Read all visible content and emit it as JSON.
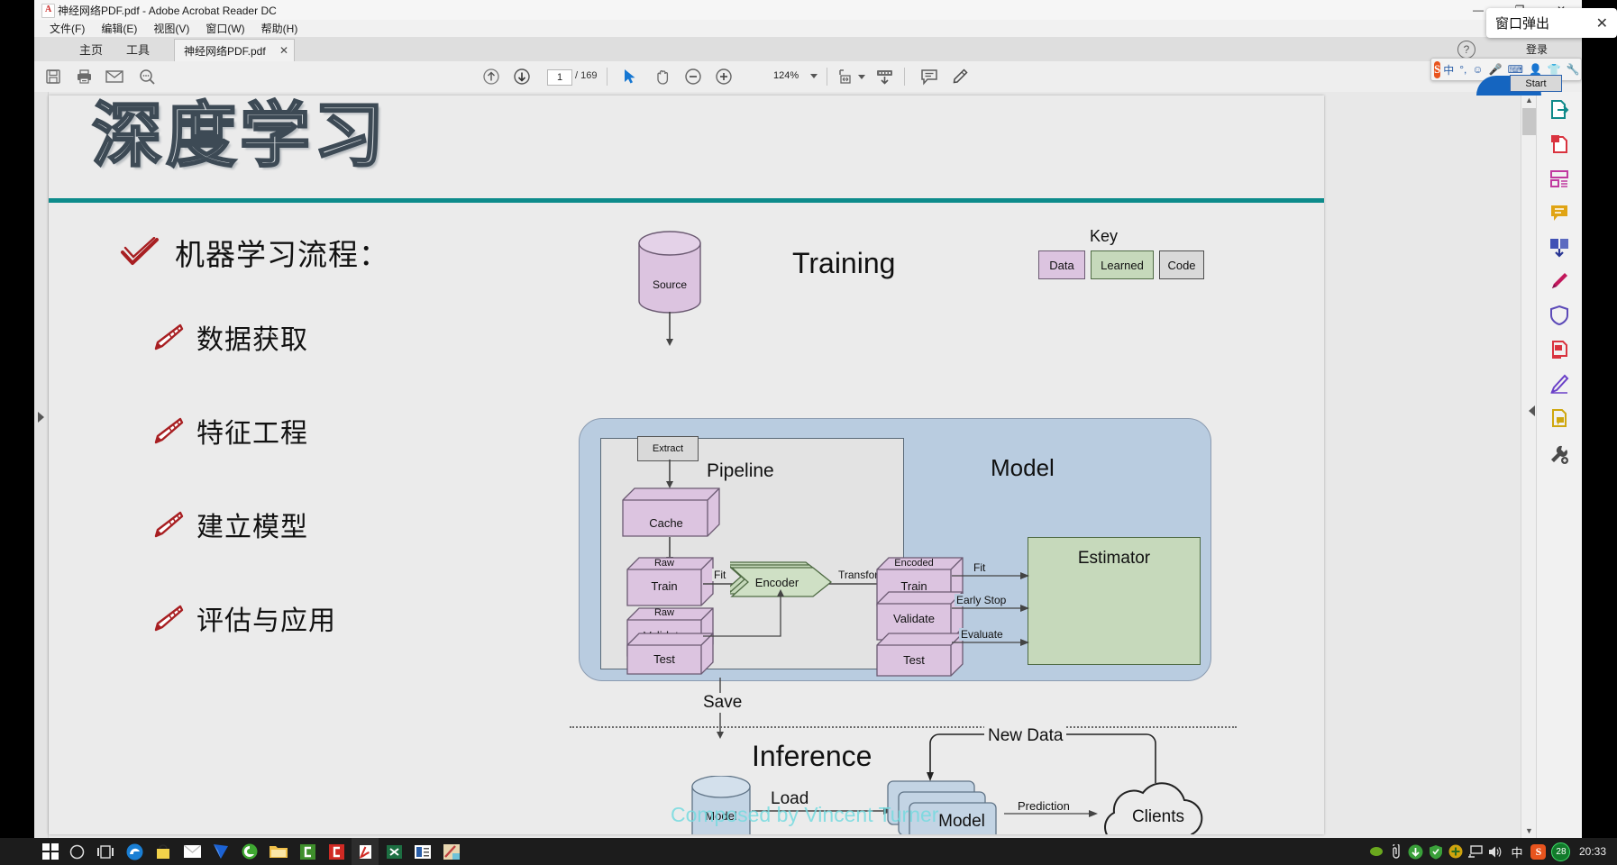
{
  "window": {
    "title": "神经网络PDF.pdf - Adobe Acrobat Reader DC",
    "minimize": "—",
    "maximize": "❐",
    "close": "✕"
  },
  "menu": [
    "文件(F)",
    "编辑(E)",
    "视图(V)",
    "窗口(W)",
    "帮助(H)"
  ],
  "tabbar": {
    "home": "主页",
    "tools": "工具",
    "document_tab": "神经网络PDF.pdf",
    "tab_close": "✕",
    "help": "?",
    "signin": "登录"
  },
  "toolbar": {
    "save_icon": "save-icon",
    "print_icon": "print-icon",
    "email_icon": "email-icon",
    "search_icon": "search-icon",
    "prev_page_icon": "arrow-up-circle-icon",
    "next_page_icon": "arrow-down-circle-icon",
    "page_current": "1",
    "page_total": "/ 169",
    "select_tool_icon": "cursor-icon",
    "hand_tool_icon": "hand-icon",
    "zoom_out_icon": "minus-circle-icon",
    "zoom_in_icon": "plus-circle-icon",
    "zoom_value": "124%",
    "zoom_dropdown_icon": "chevron-down-icon",
    "fit_page_icon": "fit-page-icon",
    "scroll_mode_icon": "scroll-mode-icon",
    "comment_icon": "comment-icon",
    "highlight_icon": "highlighter-icon"
  },
  "popup": {
    "label": "窗口弹出",
    "close": "✕"
  },
  "ime": {
    "logo": "S",
    "mode": "中",
    "items": [
      "中",
      "°,",
      "☺",
      "🎤",
      "⌨",
      "👤",
      "👕",
      "🔧"
    ],
    "start_tooltip": "Start"
  },
  "slide": {
    "title": "深度学习",
    "heading": "机器学习流程：",
    "bullets": [
      "数据获取",
      "特征工程",
      "建立模型",
      "评估与应用"
    ],
    "check_icon": "check-mark-icon",
    "bullet_icon": "pencil-icon",
    "divider_color": "#0d8b8b"
  },
  "diagram": {
    "watermark": "Composed by Vincent Turner",
    "sections": {
      "training": "Training",
      "inference": "Inference",
      "model_lane": "Model",
      "pipeline": "Pipeline"
    },
    "key": {
      "title": "Key",
      "items": [
        {
          "label": "Data",
          "color": "#dcc4e0"
        },
        {
          "label": "Learned",
          "color": "#c6d9bb"
        },
        {
          "label": "Code",
          "color": "#d9d9d9"
        }
      ]
    },
    "nodes": {
      "source": "Source",
      "extract": "Extract",
      "cache": "Cache",
      "raw_train_top": "Raw",
      "raw_train": "Train",
      "raw_validate_top": "Raw",
      "raw_validate": "Validate",
      "raw_test": "Test",
      "encoder": "Encoder",
      "encoded_train_top": "Encoded",
      "encoded_train": "Train",
      "encoded_validate": "Validate",
      "encoded_test": "Test",
      "estimator": "Estimator",
      "saved_model": "Model",
      "inference_model": "Model",
      "clients": "Clients"
    },
    "edges": {
      "fit_encoder": "Fit",
      "transform": "Transform",
      "fit_model": "Fit",
      "early_stop": "Early Stop",
      "evaluate": "Evaluate",
      "save": "Save",
      "load": "Load",
      "new_data": "New Data",
      "prediction": "Prediction"
    }
  },
  "taskbar": {
    "start_icon": "windows-start-icon",
    "items": [
      "search-circle-icon",
      "task-view-icon",
      "edge-icon",
      "store-icon",
      "mail-icon",
      "blue-app-icon",
      "browser-icon",
      "folder-icon",
      "green-app-icon",
      "red-app-icon",
      "acrobat-icon",
      "excel-icon",
      "news-icon",
      "paint-icon"
    ],
    "tray": [
      "nvidia-icon",
      "usb-icon",
      "download-icon",
      "shield-icon",
      "plus-icon",
      "network-icon",
      "volume-icon"
    ],
    "ime_mode": "中",
    "sogou_icon": "S",
    "badge_count": "28",
    "clock": "20:33"
  }
}
